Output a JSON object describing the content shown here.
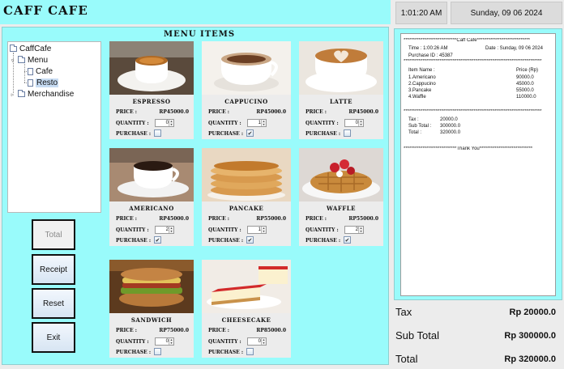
{
  "app": {
    "title": "CAFF CAFE"
  },
  "header": {
    "time": "1:01:20 AM",
    "date": "Sunday, 09 06 2024"
  },
  "menu": {
    "title": "MENU ITEMS"
  },
  "tree": {
    "root": "CaffCafe",
    "menu": "Menu",
    "cafe": "Cafe",
    "resto": "Resto",
    "merch": "Merchandise"
  },
  "buttons": {
    "total": "Total",
    "receipt": "Receipt",
    "reset": "Reset",
    "exit": "Exit"
  },
  "labels": {
    "price": "PRICE :",
    "quantity": "QUANTITY :",
    "purchase": "PURCHASE :"
  },
  "items": [
    {
      "name": "ESPRESSO",
      "price": "RP45000.0",
      "quantity": "0",
      "purchased": "",
      "image": "espresso-cup"
    },
    {
      "name": "CAPPUCINO",
      "price": "RP45000.0",
      "quantity": "1",
      "purchased": "✔",
      "image": "cappuccino-cup"
    },
    {
      "name": "LATTE",
      "price": "RP45000.0",
      "quantity": "0",
      "purchased": "",
      "image": "latte-cup"
    },
    {
      "name": "AMERICANO",
      "price": "RP45000.0",
      "quantity": "2",
      "purchased": "✔",
      "image": "americano-cup"
    },
    {
      "name": "PANCAKE",
      "price": "RP55000.0",
      "quantity": "1",
      "purchased": "✔",
      "image": "pancake-stack"
    },
    {
      "name": "WAFFLE",
      "price": "RP55000.0",
      "quantity": "2",
      "purchased": "✔",
      "image": "waffle-plate"
    },
    {
      "name": "SANDWICH",
      "price": "RP75000.0",
      "quantity": "0",
      "purchased": "",
      "image": "sandwich"
    },
    {
      "name": "CHEESECAKE",
      "price": "RP85000.0",
      "quantity": "0",
      "purchased": "",
      "image": "cheesecake"
    }
  ],
  "receipt": {
    "header_line": "****************************Caff Cafe****************************",
    "time": "Time : 1:00:26 AM",
    "date": "Date : Sunday, 09 06 2024",
    "purchase_id": "Purchase ID : 45387",
    "sep1": "*************************************************************************",
    "item_col": "Item Name :",
    "price_col": "Price (Rp)",
    "lines": [
      {
        "name": " 1.Americano",
        "price": "90000.0"
      },
      {
        "name": "2.Cappucino",
        "price": "45000.0"
      },
      {
        "name": "3.Pancake",
        "price": "55000.0"
      },
      {
        "name": "4.Waffle",
        "price": "110000.0"
      }
    ],
    "sep2": "*************************************************************************",
    "tax_label": "Tax :",
    "tax_value": "20000.0",
    "subtotal_label": "Sub Total :",
    "subtotal_value": "300000.0",
    "total_label": "Total :",
    "total_value": "320000.0",
    "footer_line": "****************************Thank You****************************"
  },
  "totals": {
    "tax_label": "Tax",
    "tax_value": "Rp 20000.0",
    "subtotal_label": "Sub Total",
    "subtotal_value": "Rp 300000.0",
    "total_label": "Total",
    "total_value": "Rp 320000.0"
  },
  "colors": {
    "panel": "#99fbfb",
    "card": "#ececec",
    "background": "#ececec"
  }
}
